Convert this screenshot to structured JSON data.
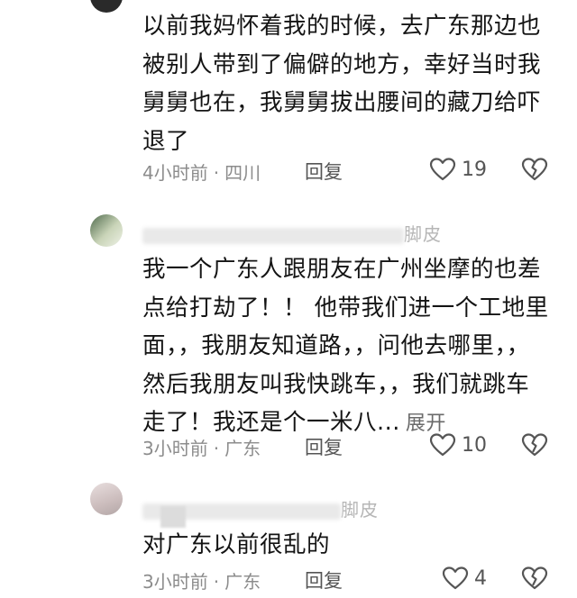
{
  "comments": [
    {
      "username": "",
      "lines": [
        "以前我妈怀着我的时候，去广东那边也",
        "被别人带到了偏僻的地方，幸好当时我",
        "舅舅也在，我舅舅拔出腰间的藏刀给吓",
        "退了"
      ],
      "time": "4小时前",
      "location": "四川",
      "reply_label": "回复",
      "likes": "19",
      "expand_label": ""
    },
    {
      "username": "脚皮",
      "lines": [
        "我一个广东人跟朋友在广州坐摩的也差",
        "点给打劫了！！ 他带我们进一个工地里",
        "面，，我朋友知道路，，问他去哪里，，",
        "然后我朋友叫我快跳车，，我们就跳车",
        "走了！我还是个一米八..."
      ],
      "time": "3小时前",
      "location": "广东",
      "reply_label": "回复",
      "likes": "10",
      "expand_label": "展开"
    },
    {
      "username": "脚皮",
      "lines": [
        "对广东以前很乱的"
      ],
      "time": "3小时前",
      "location": "广东",
      "reply_label": "回复",
      "likes": "4",
      "expand_label": ""
    }
  ],
  "meta_separator": "·",
  "icons": {
    "like": "heart-outline-icon",
    "dislike": "broken-heart-outline-icon"
  },
  "colors": {
    "text": "#141414",
    "meta": "#8c8c8c",
    "icon": "#555555"
  }
}
